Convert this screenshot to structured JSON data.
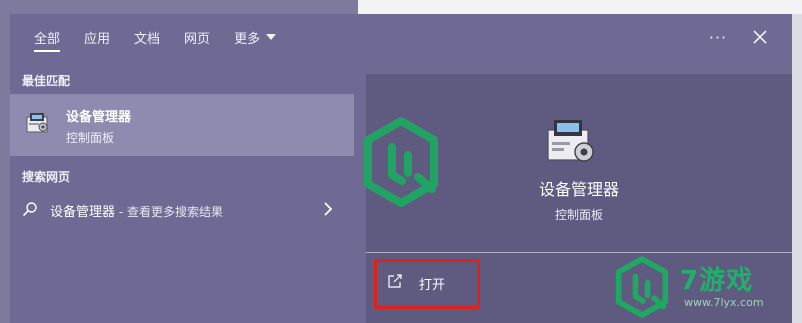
{
  "tabs": [
    {
      "label": "全部",
      "active": true
    },
    {
      "label": "应用",
      "active": false
    },
    {
      "label": "文档",
      "active": false
    },
    {
      "label": "网页",
      "active": false
    },
    {
      "label": "更多",
      "active": false
    }
  ],
  "toolbar": {
    "more_icon": "ellipsis-icon",
    "more_text": "···",
    "close_icon": "close-icon"
  },
  "left": {
    "best_match_label": "最佳匹配",
    "best_match": {
      "title": "设备管理器",
      "subtitle": "控制面板",
      "icon": "device-manager-icon"
    },
    "web_label": "搜索网页",
    "web_item": {
      "query": "设备管理器",
      "suffix": " - 查看更多搜索结果",
      "icon": "search-icon"
    }
  },
  "detail": {
    "title": "设备管理器",
    "subtitle": "控制面板",
    "action_label": "打开",
    "action_icon": "open-external-icon"
  },
  "watermark": {
    "brand": "7游戏",
    "url": "www.7lyx.com"
  },
  "colors": {
    "panel": "#6e6a93",
    "selected": "#8e8ab0",
    "detail": "#5f5a80",
    "highlight_border": "#e0221b",
    "watermark": "#20b06a"
  }
}
